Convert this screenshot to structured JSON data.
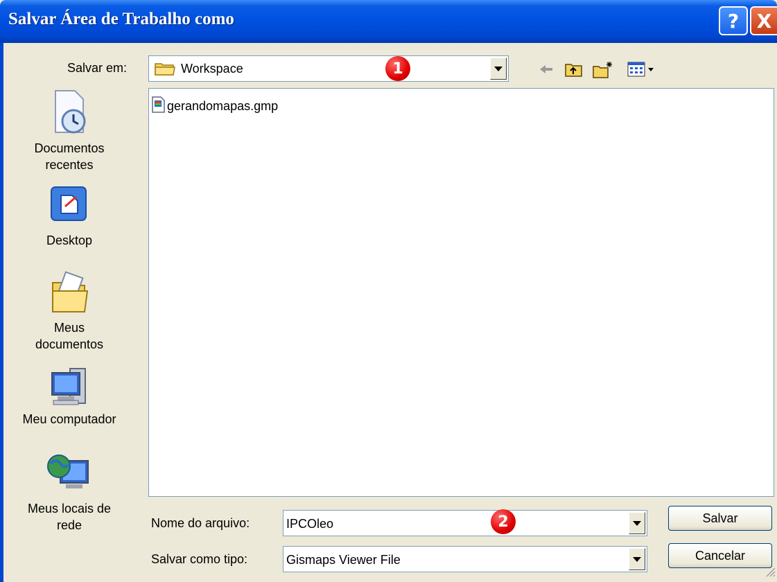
{
  "window": {
    "title": "Salvar Área de Trabalho como",
    "help_glyph": "?",
    "close_glyph": "X"
  },
  "save_in": {
    "label": "Salvar em:",
    "value": "Workspace",
    "icon": "folder-icon"
  },
  "toolbar": {
    "icons": [
      "back-arrow-icon",
      "up-folder-icon",
      "new-folder-icon",
      "view-menu-icon"
    ]
  },
  "places": [
    {
      "label_lines": [
        "Documentos",
        "recentes"
      ],
      "icon": "recent-documents-icon"
    },
    {
      "label_lines": [
        "Desktop"
      ],
      "icon": "desktop-icon"
    },
    {
      "label_lines": [
        "Meus",
        "documentos"
      ],
      "icon": "my-documents-icon"
    },
    {
      "label_lines": [
        "Meu computador"
      ],
      "icon": "my-computer-icon"
    },
    {
      "label_lines": [
        "Meus locais de",
        "rede"
      ],
      "icon": "network-places-icon"
    }
  ],
  "files": [
    {
      "name": "gerandomapas.gmp",
      "icon": "gmp-file-icon"
    }
  ],
  "filename": {
    "label": "Nome do arquivo:",
    "value": "IPCOleo"
  },
  "filetype": {
    "label": "Salvar como tipo:",
    "value": "Gismaps Viewer File"
  },
  "buttons": {
    "save": "Salvar",
    "cancel": "Cancelar"
  },
  "annotations": [
    "1",
    "2"
  ],
  "colors": {
    "titlebar": "#0050e0",
    "dialog_bg": "#ece9d8",
    "annotation_badge": "#e00000"
  }
}
